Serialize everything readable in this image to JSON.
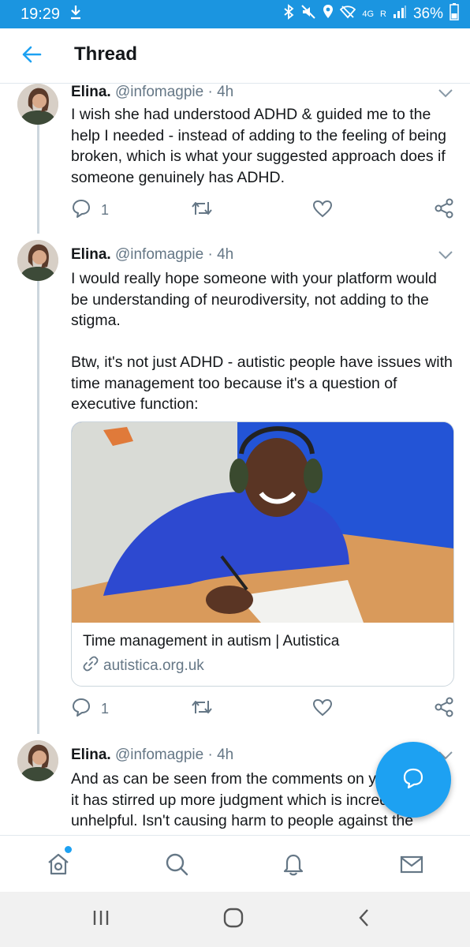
{
  "status_bar": {
    "time": "19:29",
    "network": "4G",
    "roaming": "R",
    "battery": "36%"
  },
  "header": {
    "title": "Thread",
    "back_icon": "arrow-left-icon"
  },
  "tweets": [
    {
      "name": "Elina.",
      "handle": "@infomagpie",
      "time": "· 4h",
      "text": "I wish she had understood ADHD & guided me to the help I needed - instead of adding to the feeling of being broken, which is what your suggested approach does if someone genuinely has ADHD.",
      "reply_count": "1"
    },
    {
      "name": "Elina.",
      "handle": "@infomagpie",
      "time": "· 4h",
      "text": "I would really hope someone with your platform would be understanding of neurodiversity, not adding to the stigma.\n\nBtw, it's not just ADHD - autistic people have issues with time management too because it's a question of executive function:",
      "reply_count": "1",
      "card": {
        "title": "Time management in autism | Autistica",
        "domain": "autistica.org.uk"
      }
    },
    {
      "name": "Elina.",
      "handle": "@infomagpie",
      "time": "· 4h",
      "text": "And as can be seen from the comments on your article, it has stirred up more judgment which is incredibly unhelpful. Isn't causing harm to people against the ethics of your profession?"
    }
  ],
  "tab_bar": {
    "items": [
      "home-icon",
      "search-icon",
      "bell-icon",
      "mail-icon"
    ],
    "accent": "#1da1f2"
  },
  "colors": {
    "brand": "#1da1f2",
    "status_bar": "#1b95e0",
    "secondary_text": "#657786"
  }
}
